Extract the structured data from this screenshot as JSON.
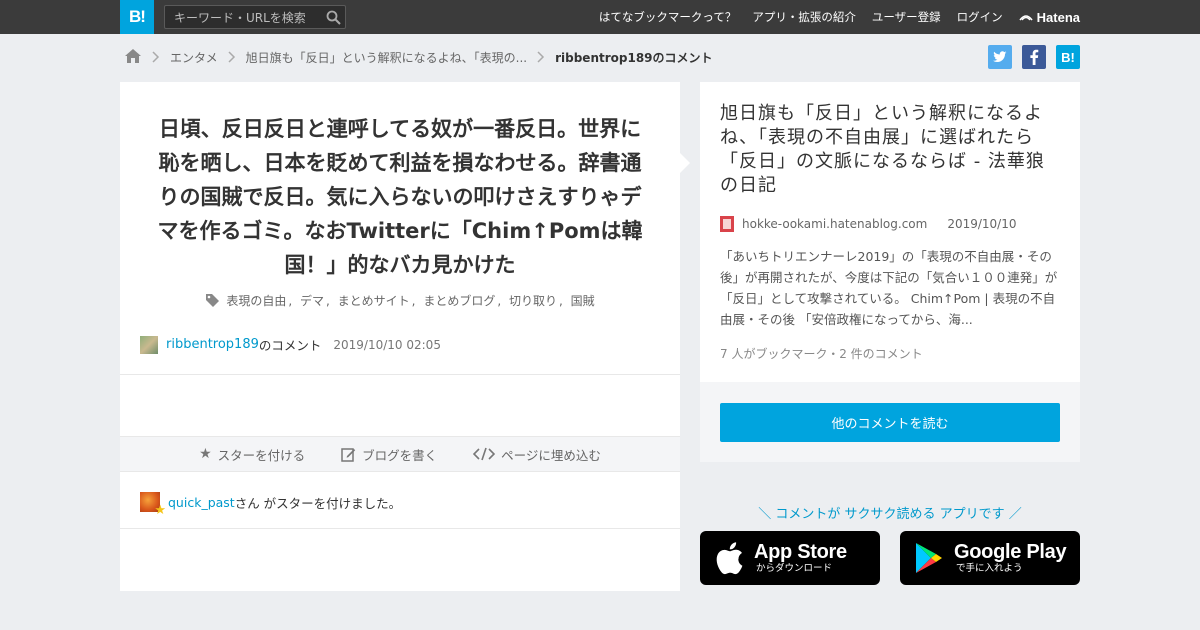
{
  "topbar": {
    "logo": "B!",
    "search_placeholder": "キーワード・URLを検索",
    "nav": [
      "はてなブックマークって？",
      "アプリ・拡張の紹介",
      "ユーザー登録",
      "ログイン"
    ],
    "brand": "Hatena"
  },
  "breadcrumb": [
    "エンタメ",
    "旭日旗も「反日」という解釈になるよね、「表現の...",
    "ribbentrop189のコメント"
  ],
  "share": [
    {
      "label": "twitter-icon",
      "color": "#55acee"
    },
    {
      "label": "facebook-icon",
      "color": "#3b5998"
    },
    {
      "label": "B!",
      "color": "#00a4de"
    }
  ],
  "comment": {
    "text": "日頃、反日反日と連呼してる奴が一番反日。世界に恥を晒し、日本を貶めて利益を損なわせる。辞書通りの国賊で反日。気に入らないの叩けさえすりゃデマを作るゴミ。なおTwitterに「Chim↑Pomは韓国！」的なバカ見かけた",
    "tags": [
      "表現の自由",
      "デマ",
      "まとめサイト",
      "まとめブログ",
      "切り取り",
      "国賊"
    ],
    "user": "ribbentrop189",
    "user_suffix": "のコメント",
    "datetime": "2019/10/10 02:05"
  },
  "actions": {
    "star": "スターを付ける",
    "blog": "ブログを書く",
    "embed": "ページに埋め込む"
  },
  "stars": {
    "user": "quick_past",
    "text": "さん がスターを付けました。"
  },
  "entry": {
    "title": "旭日旗も「反日」という解釈になるよね、「表現の不自由展」に選ばれたら「反日」の文脈になるならば - 法華狼の日記",
    "site": "hokke-ookami.hatenablog.com",
    "date": "2019/10/10",
    "description": "「あいちトリエンナーレ2019」の「表現の不自由展・その後」が再開されたが、今度は下記の「気合い１００連発」が「反日」として攻撃されている。 Chim↑Pom | 表現の不自由展・その後 「安倍政権になってから、海...",
    "counts": "7 人がブックマーク・2 件のコメント",
    "read_button": "他のコメントを読む"
  },
  "promo": "＼ コメントが サクサク読める アプリです ／",
  "stores": {
    "apple_big": "App Store",
    "apple_small": "からダウンロード",
    "google_big": "Google Play",
    "google_small": "で手に入れよう"
  }
}
